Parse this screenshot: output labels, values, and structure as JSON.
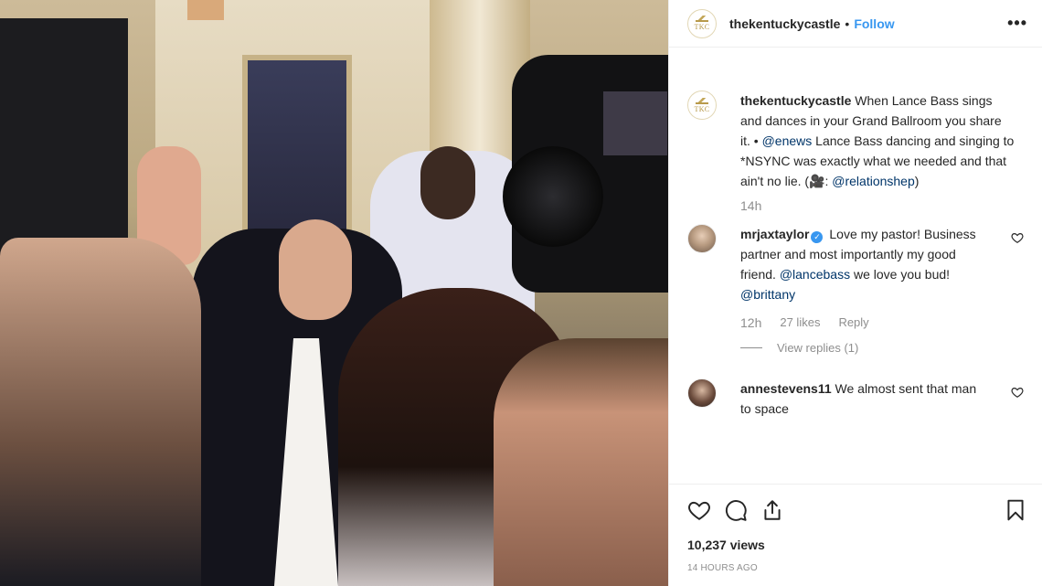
{
  "post": {
    "author": "thekentuckycastle",
    "avatar_monogram": "TKC",
    "separator": "•",
    "follow_label": "Follow",
    "more_label": "•••",
    "caption": {
      "username": "thekentuckycastle",
      "text_1": " When Lance Bass sings and dances in your Grand Ballroom you share it. • ",
      "mention_1": "@enews",
      "text_2": " Lance Bass dancing and singing to *NSYNC was exactly what we needed and that ain't no lie. (🎥: ",
      "mention_2": "@relationshep",
      "text_3": ")",
      "time": "14h"
    },
    "comments": [
      {
        "username": "mrjaxtaylor",
        "verified": true,
        "text_1": " Love my pastor! Business partner and most importantly my good friend. ",
        "mention_1": "@lancebass",
        "text_2": " we love you bud! ",
        "mention_2": "@brittany",
        "time": "12h",
        "likes": "27 likes",
        "reply_label": "Reply",
        "view_replies": "View replies (1)"
      },
      {
        "username": "annestevens11",
        "text": " We almost sent that man to space"
      }
    ],
    "views": "10,237 views",
    "date": "14 HOURS AGO"
  },
  "icons": {
    "like": "heart-icon",
    "comment": "comment-icon",
    "share": "share-icon",
    "save": "bookmark-icon",
    "more": "more-options-icon"
  },
  "colors": {
    "link": "#003569",
    "follow": "#3897f0",
    "muted": "#8e8e8e",
    "brand_gold": "#b89a4b"
  }
}
